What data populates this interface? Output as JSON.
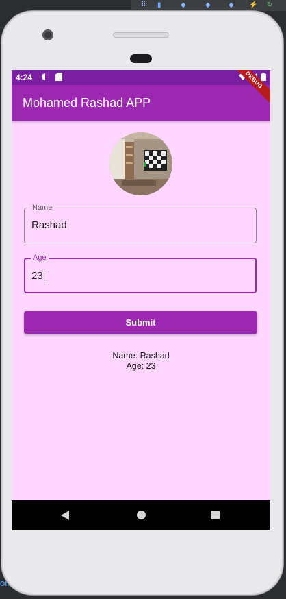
{
  "status_bar": {
    "time": "4:24"
  },
  "app_bar": {
    "title": "Mohamed Rashad APP",
    "debug_banner": "DEBUG"
  },
  "form": {
    "name_field": {
      "label": "Name",
      "value": "Rashad"
    },
    "age_field": {
      "label": "Age",
      "value": "23"
    },
    "submit_label": "Submit"
  },
  "result": {
    "name_line": "Name: Rashad",
    "age_line": "Age: 23"
  },
  "ide": {
    "side_text": "on"
  },
  "colors": {
    "primary": "#9c27b0",
    "status_bar": "#7b1fa2",
    "background": "#ffd6ff",
    "debug_ribbon": "#b71c1c"
  },
  "icons": [
    "camera-icon",
    "speaker-grille",
    "wifi-icon",
    "signal-icon",
    "battery-icon",
    "back-icon",
    "home-icon",
    "recents-icon"
  ]
}
